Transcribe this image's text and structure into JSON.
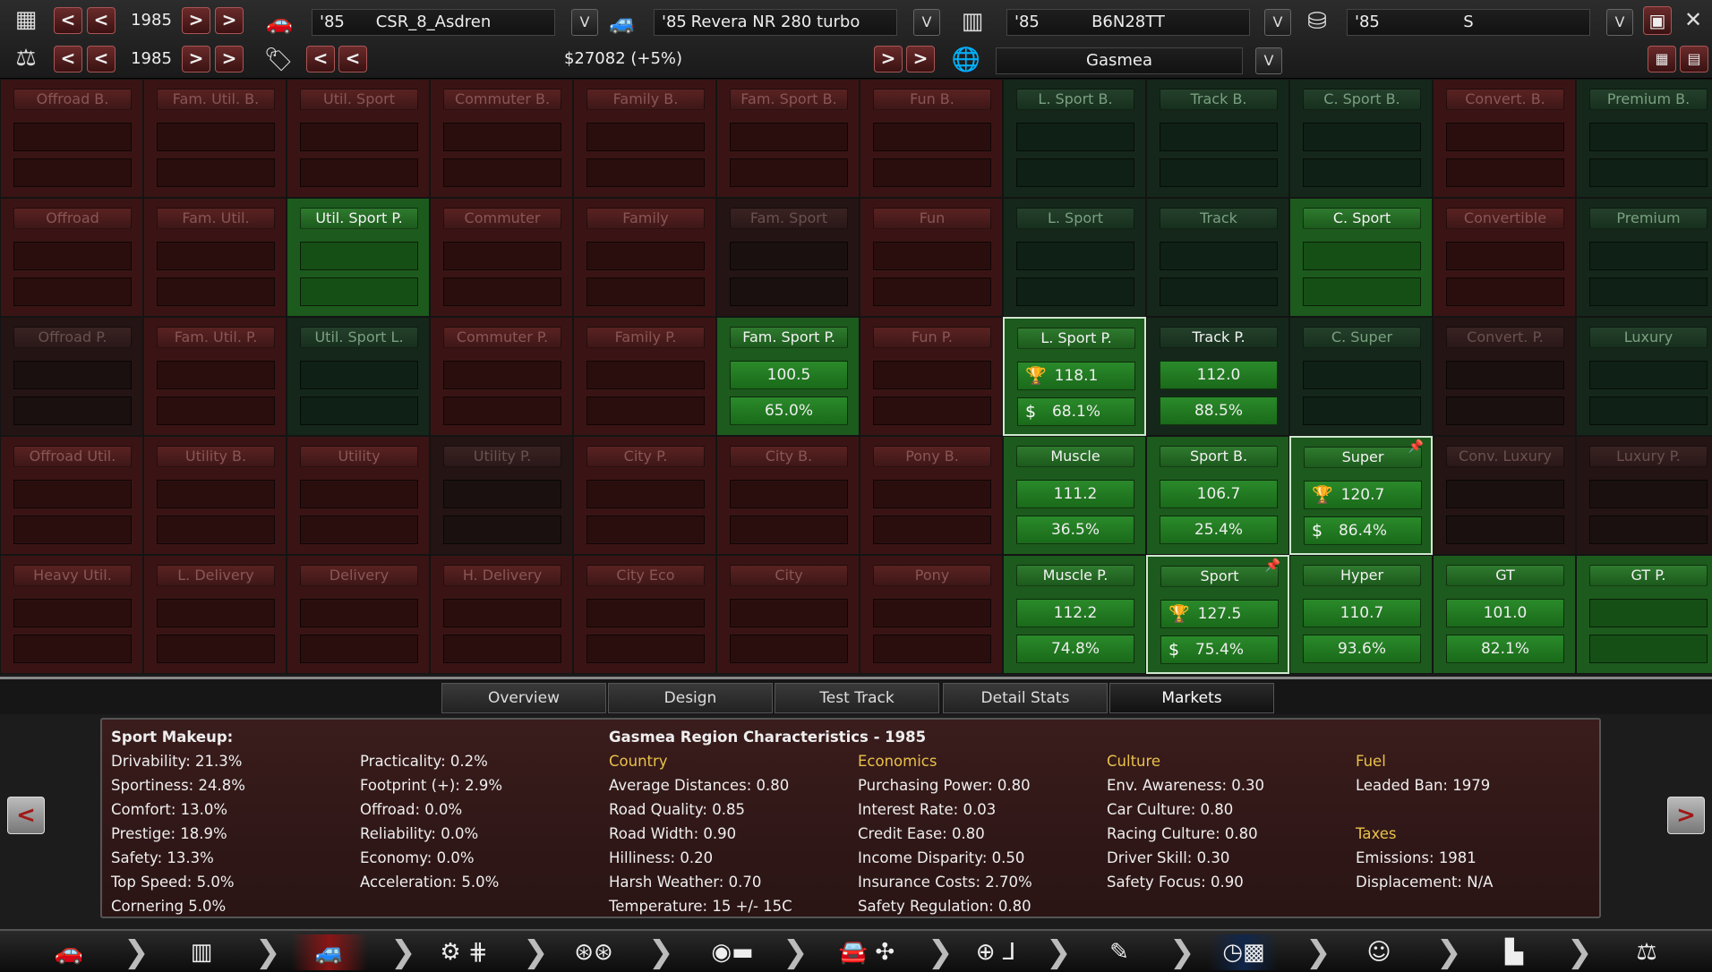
{
  "top": {
    "row1": {
      "year": "1985",
      "fields": [
        {
          "year": "'85",
          "name": "CSR_8_Asdren"
        },
        {
          "year": "'85",
          "name": "Revera NR 280 turbo"
        },
        {
          "year": "'85",
          "name": "B6N28TT"
        },
        {
          "year": "'85",
          "name": "S"
        }
      ]
    },
    "row2": {
      "year": "1985",
      "price": "$27082 (+5%)",
      "region": "Gasmea"
    },
    "btn": {
      "prev": "<",
      "next": ">",
      "dropdown": "V"
    }
  },
  "grid": {
    "cells": [
      [
        {
          "label": "Offroad B."
        },
        {
          "label": "Fam. Util. B."
        },
        {
          "label": "Util. Sport"
        },
        {
          "label": "Commuter B."
        },
        {
          "label": "Family B."
        },
        {
          "label": "Fam. Sport B."
        },
        {
          "label": "Fun B."
        },
        {
          "label": "L. Sport B."
        },
        {
          "label": "Track B."
        },
        {
          "label": "C. Sport B."
        },
        {
          "label": "Convert. B."
        },
        {
          "label": "Premium B."
        }
      ],
      [
        {
          "label": "Offroad"
        },
        {
          "label": "Fam. Util."
        },
        {
          "label": "Util. Sport P."
        },
        {
          "label": "Commuter"
        },
        {
          "label": "Family"
        },
        {
          "label": "Fam. Sport"
        },
        {
          "label": "Fun"
        },
        {
          "label": "L. Sport"
        },
        {
          "label": "Track"
        },
        {
          "label": "C. Sport"
        },
        {
          "label": "Convertible"
        },
        {
          "label": "Premium"
        }
      ],
      [
        {
          "label": "Offroad P."
        },
        {
          "label": "Fam. Util. P."
        },
        {
          "label": "Util. Sport L."
        },
        {
          "label": "Commuter P."
        },
        {
          "label": "Family P."
        },
        {
          "label": "Fam. Sport P.",
          "v1": "100.5",
          "v2": "65.0%"
        },
        {
          "label": "Fun P."
        },
        {
          "label": "L. Sport P.",
          "v1": "118.1",
          "v2": "68.1%",
          "icons": true
        },
        {
          "label": "Track P.",
          "v1": "112.0",
          "v2": "88.5%"
        },
        {
          "label": "C. Super"
        },
        {
          "label": "Convert. P."
        },
        {
          "label": "Luxury"
        }
      ],
      [
        {
          "label": "Offroad Util."
        },
        {
          "label": "Utility B."
        },
        {
          "label": "Utility"
        },
        {
          "label": "Utility P."
        },
        {
          "label": "City P."
        },
        {
          "label": "City B."
        },
        {
          "label": "Pony B."
        },
        {
          "label": "Muscle",
          "v1": "111.2",
          "v2": "36.5%"
        },
        {
          "label": "Sport B.",
          "v1": "106.7",
          "v2": "25.4%"
        },
        {
          "label": "Super",
          "v1": "120.7",
          "v2": "86.4%",
          "icons": true,
          "pinned": true
        },
        {
          "label": "Conv. Luxury"
        },
        {
          "label": "Luxury P."
        }
      ],
      [
        {
          "label": "Heavy Util."
        },
        {
          "label": "L. Delivery"
        },
        {
          "label": "Delivery"
        },
        {
          "label": "H. Delivery"
        },
        {
          "label": "City Eco"
        },
        {
          "label": "City"
        },
        {
          "label": "Pony"
        },
        {
          "label": "Muscle P.",
          "v1": "112.2",
          "v2": "74.8%"
        },
        {
          "label": "Sport",
          "v1": "127.5",
          "v2": "75.4%",
          "icons": true,
          "pinned": true
        },
        {
          "label": "Hyper",
          "v1": "110.7",
          "v2": "93.6%"
        },
        {
          "label": "GT",
          "v1": "101.0",
          "v2": "82.1%"
        },
        {
          "label": "GT P."
        }
      ]
    ],
    "colors": [
      [
        "red",
        "red",
        "red",
        "red",
        "red",
        "red",
        "red",
        "dkgreen",
        "dkgreen",
        "dkgreen",
        "red",
        "dkgreen"
      ],
      [
        "red",
        "red",
        "green",
        "red",
        "red",
        "dkred",
        "red",
        "dkgreen",
        "dkgreen",
        "green",
        "red",
        "dkgreen"
      ],
      [
        "dkred",
        "red",
        "dkgreen",
        "red",
        "red",
        "green",
        "red",
        "green",
        "dkgreen",
        "dkgreen",
        "dkred",
        "dkgreen"
      ],
      [
        "red",
        "red",
        "red",
        "dkred",
        "red",
        "red",
        "red",
        "green",
        "green",
        "green",
        "dkred",
        "dkred"
      ],
      [
        "red",
        "red",
        "red",
        "red",
        "red",
        "red",
        "red",
        "green",
        "green",
        "green",
        "green",
        "green"
      ]
    ]
  },
  "tabs": [
    {
      "label": "Overview"
    },
    {
      "label": "Design"
    },
    {
      "label": "Test Track"
    },
    {
      "label": "Detail Stats"
    },
    {
      "label": "Markets",
      "active": true
    }
  ],
  "info": {
    "makeup_title": "Sport Makeup:",
    "makeup_col1": [
      "Drivability: 21.3%",
      "Sportiness: 24.8%",
      "Comfort: 13.0%",
      "Prestige: 18.9%",
      "Safety: 13.3%",
      "Top Speed: 5.0%",
      "Cornering 5.0%"
    ],
    "makeup_col2": [
      "Practicality: 0.2%",
      "Footprint (+): 2.9%",
      "Offroad: 0.0%",
      "Reliability: 0.0%",
      "Economy: 0.0%",
      "Acceleration: 5.0%"
    ],
    "region_title": "Gasmea Region Characteristics - 1985",
    "country_head": "Country",
    "country": [
      "Average Distances: 0.80",
      "Road Quality: 0.85",
      "Road Width: 0.90",
      "Hilliness: 0.20",
      "Harsh Weather: 0.70",
      "Temperature: 15 +/- 15C"
    ],
    "economics_head": "Economics",
    "economics": [
      "Purchasing Power: 0.80",
      "Interest Rate: 0.03",
      "Credit Ease: 0.80",
      "Income Disparity: 0.50",
      "Insurance Costs: 2.70%",
      "Safety Regulation: 0.80"
    ],
    "culture_head": "Culture",
    "culture": [
      "Env. Awareness: 0.30",
      "Car Culture: 0.80",
      "Racing Culture: 0.80",
      "Driver Skill: 0.30",
      "Safety Focus: 0.90"
    ],
    "fuel_head": "Fuel",
    "fuel": [
      "Leaded Ban: 1979"
    ],
    "taxes_head": "Taxes",
    "taxes": [
      "Emissions: 1981",
      "Displacement: N/A"
    ]
  },
  "nav": {
    "left": "<",
    "right": ">"
  },
  "bottom": {
    "chevron": "❯"
  },
  "palette": {
    "red": "#3a1414",
    "dkred": "#241414",
    "green": "#1d5a1d",
    "dkgreen": "#15271a",
    "accent": "#e8c14a"
  }
}
